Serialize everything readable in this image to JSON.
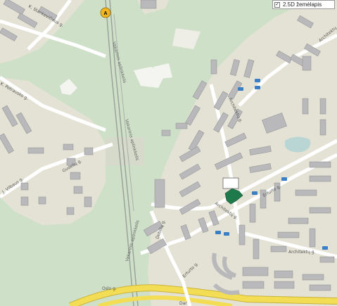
{
  "layer_toggle": {
    "label": "2.5D žemėlapis",
    "checked": true
  },
  "marker": {
    "letter": "A"
  },
  "streets": {
    "k_stankeviciaus": "K. Stankevičiaus g.",
    "k_petrausko": "K. Petrausko g.",
    "j_vilbaus": "J. Vilbaus g.",
    "s_ciurlionio": "Architektų g.",
    "gudeliu": "Gudelių g.",
    "vaksniai_1": "Vakarinis aplinkkelis",
    "vaksniai_2": "Vakarinis aplinkkelis",
    "vaksniai_3": "Vakarinis aplinkkelis",
    "architektu_top": "Architektų g.",
    "architektu_mid": "Architektų g.",
    "architektu_low": "Architektų g.",
    "architektu_right": "Architektų",
    "architektu_east": "Architektų g.",
    "erfurto_1": "Erfurto g.",
    "erfurto_2": "Erfurto g.",
    "dobiliu": "Dobilių g.",
    "oslo": "Oslo g.",
    "dariaus": "Dar"
  },
  "colors": {
    "park": "#cfe0c9",
    "urban": "#e4e2d5",
    "road_major": "#f3dd54",
    "road_minor": "#ffffff",
    "building": "#b9b9bb",
    "highlight_building": "#1f7a4b",
    "marker": "#f2b51f"
  }
}
